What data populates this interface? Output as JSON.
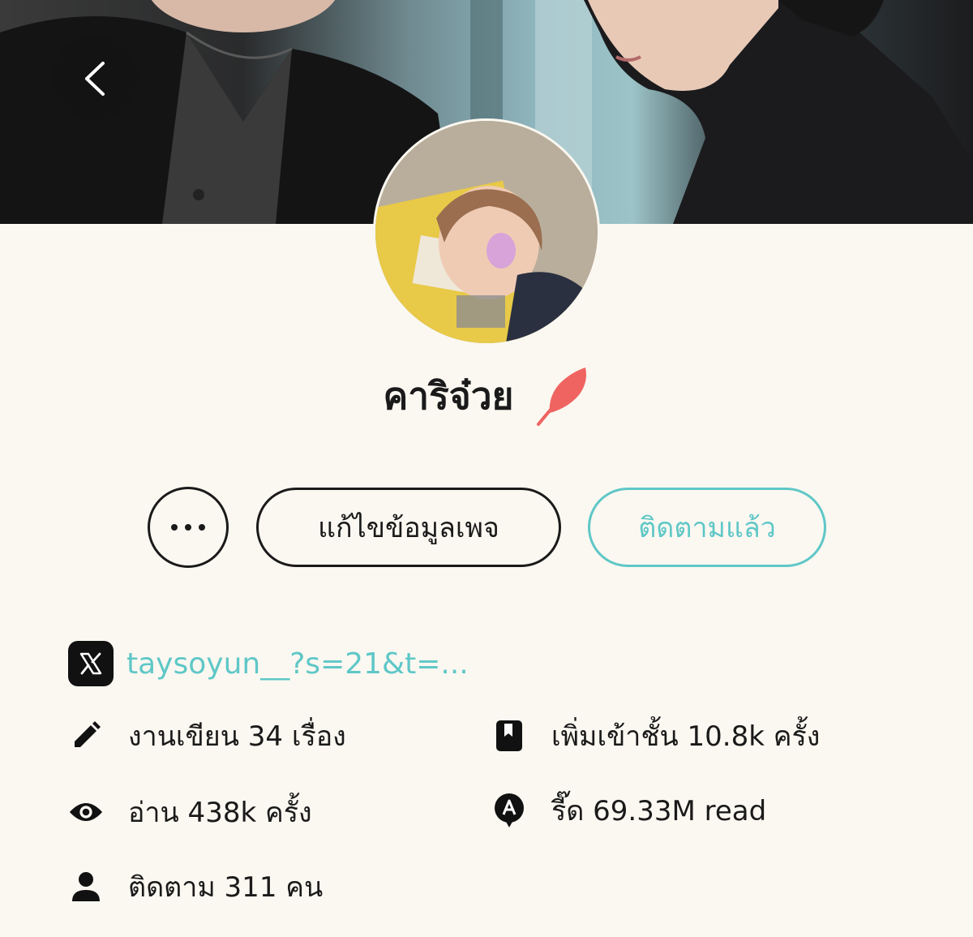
{
  "profile": {
    "name": "คาริจ๋วย",
    "badge_icon": "feather-icon",
    "badge_color": "#ef6461"
  },
  "actions": {
    "more_label": "•••",
    "edit_label": "แก้ไขข้อมูลเพจ",
    "follow_label": "ติดตามแล้ว"
  },
  "social": {
    "icon": "x-logo-icon",
    "handle": "taysoyun__?s=21&t=..."
  },
  "stats": {
    "works": "งานเขียน 34 เรื่อง",
    "shelf": "เพิ่มเข้าชั้น 10.8k ครั้ง",
    "reads": "อ่าน 438k ครั้ง",
    "read_count": "รี๊ด 69.33M read",
    "followers": "ติดตาม 311 คน"
  },
  "colors": {
    "accent": "#5fc7c7",
    "background": "#fbf8f1",
    "text": "#1a1a1a"
  }
}
